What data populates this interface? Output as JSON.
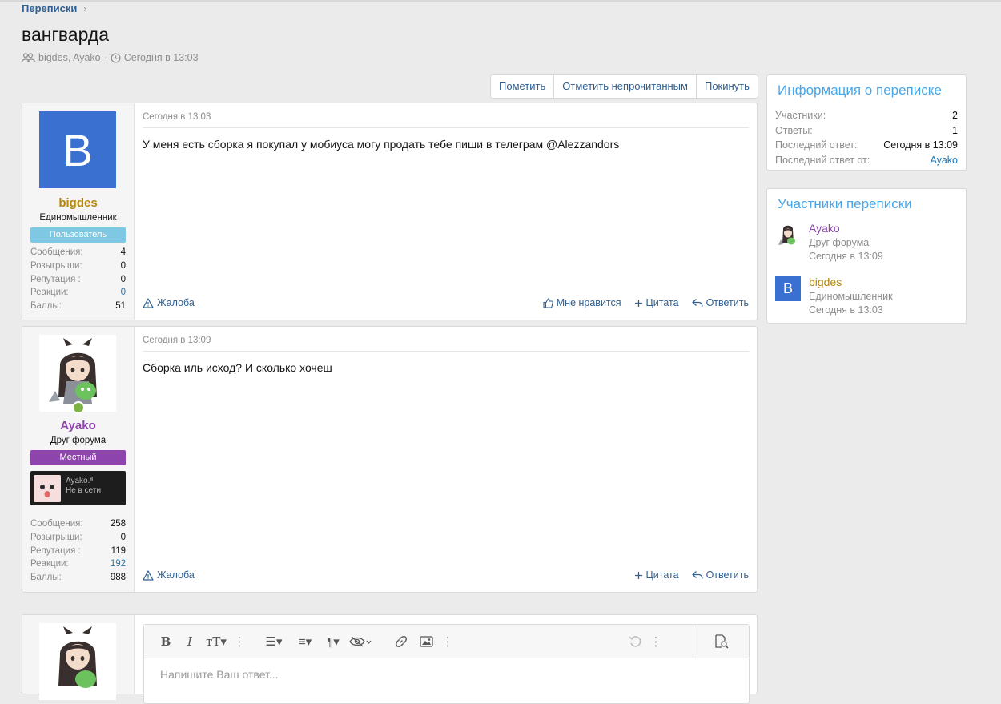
{
  "breadcrumb": {
    "item": "Переписки"
  },
  "title": "вангварда",
  "meta": {
    "participants": "bigdes, Ayako",
    "sep": "·",
    "date": "Сегодня в 13:03"
  },
  "buttons": {
    "mark": "Пометить",
    "mark_unread": "Отметить непрочитанным",
    "leave": "Покинуть"
  },
  "messages": [
    {
      "date": "Сегодня в 13:03",
      "body": "У меня есть сборка я покупал у мобиуса могу продать тебе пиши в телеграм @Alezzandors",
      "user": {
        "avatar_letter": "B",
        "name": "bigdes",
        "title": "Единомышленник",
        "banner": "Пользователь",
        "stats": [
          {
            "label": "Сообщения:",
            "value": "4"
          },
          {
            "label": "Розыгрыши:",
            "value": "0"
          },
          {
            "label": "Репутация :",
            "value": "0"
          },
          {
            "label": "Реакции:",
            "value": "0"
          },
          {
            "label": "Баллы:",
            "value": "51"
          }
        ]
      },
      "actions": {
        "report": "Жалоба",
        "like": "Мне нравится",
        "quote": "Цитата",
        "reply": "Ответить"
      }
    },
    {
      "date": "Сегодня в 13:09",
      "body": "Сборка иль исход? И сколько хочеш",
      "user": {
        "name": "Ayako",
        "title": "Друг форума",
        "banner": "Местный",
        "status_name": "Ayako.ª",
        "status_text": "Не в сети",
        "stats": [
          {
            "label": "Сообщения:",
            "value": "258"
          },
          {
            "label": "Розыгрыши:",
            "value": "0"
          },
          {
            "label": "Репутация :",
            "value": "119"
          },
          {
            "label": "Реакции:",
            "value": "192"
          },
          {
            "label": "Баллы:",
            "value": "988"
          }
        ]
      },
      "actions": {
        "report": "Жалоба",
        "quote": "Цитата",
        "reply": "Ответить"
      }
    }
  ],
  "sidebar": {
    "info": {
      "title": "Информация о переписке",
      "rows": [
        {
          "label": "Участники:",
          "value": "2"
        },
        {
          "label": "Ответы:",
          "value": "1"
        },
        {
          "label": "Последний ответ:",
          "value": "Сегодня в 13:09"
        },
        {
          "label": "Последний ответ от:",
          "value": "Ayako"
        }
      ]
    },
    "participants": {
      "title": "Участники переписки",
      "list": [
        {
          "name": "Ayako",
          "title": "Друг форума",
          "date": "Сегодня в 13:09"
        },
        {
          "avatar_letter": "B",
          "name": "bigdes",
          "title": "Единомышленник",
          "date": "Сегодня в 13:03"
        }
      ]
    }
  },
  "editor": {
    "placeholder": "Напишите Ваш ответ..."
  },
  "colors": {
    "link": "#2d5f93",
    "bigdes_name": "#b8860b",
    "ayako_name": "#8e44ad",
    "user_banner": "#7ec8e3",
    "local_banner": "#8e44ad",
    "avatar_blue": "#3a71d1",
    "sidebar_title": "#47a7eb"
  }
}
